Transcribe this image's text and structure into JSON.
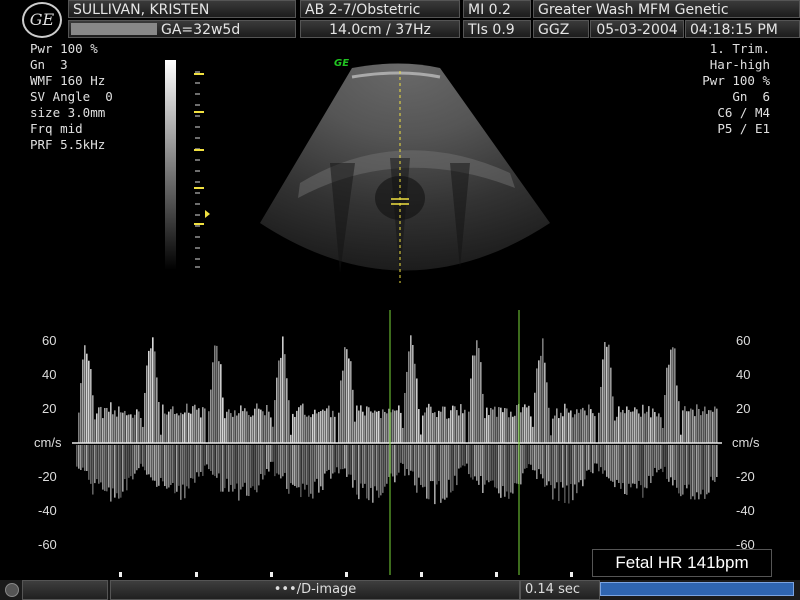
{
  "header": {
    "logo_text": "GE",
    "patient_name": "SULLIVAN, KRISTEN",
    "ga": "GA=32w5d",
    "probe": "AB 2-7/Obstetric",
    "depth_freq": "14.0cm / 37Hz",
    "mi": "MI  0.2",
    "tis": "TIs  0.9",
    "institution": "Greater Wash MFM Genetic",
    "operator": "GGZ",
    "date": "05-03-2004",
    "time": "04:18:15 PM"
  },
  "left_params": [
    "Pwr 100 %",
    "Gn  3",
    "WMF 160 Hz",
    "SV Angle  0",
    "size 3.0mm",
    "Frq mid",
    "PRF 5.5kHz"
  ],
  "right_params": [
    "1. Trim.",
    "Har-high",
    "Pwr 100 %",
    "Gn  6",
    "C6 / M4",
    "P5 / E1"
  ],
  "image_logo": "GE",
  "doppler": {
    "units": "cm/s",
    "velocity_ticks": [
      60,
      40,
      20,
      -20,
      -40,
      -60
    ]
  },
  "fetal_hr": "Fetal HR 141bpm",
  "footer": {
    "mode_label": "•••/D-image",
    "time_label": "0.14 sec"
  },
  "colors": {
    "caliper": "#f0e040",
    "marker_line": "#7ad83a",
    "scale_bar": "#2f65b0"
  }
}
